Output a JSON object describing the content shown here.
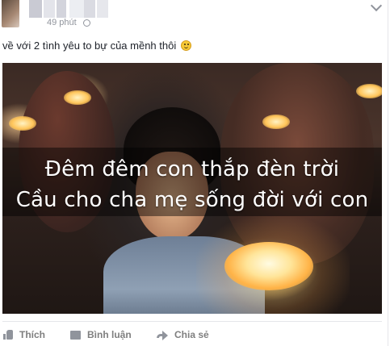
{
  "post": {
    "timestamp": "49 phút",
    "text": "về với 2 tình yêu to bự của mềnh thôi",
    "emoji": "smiley-icon",
    "privacy_icon": "globe-icon"
  },
  "photo": {
    "caption_line_1": "Đêm đêm con thắp đèn trời",
    "caption_line_2": "Cầu cho cha mẹ sống đời với con"
  },
  "actions": {
    "like_label": "Thích",
    "comment_label": "Bình luận",
    "share_label": "Chia sẻ"
  },
  "colors": {
    "text": "#1d2129",
    "meta": "#90949c",
    "action": "#7f7f7f",
    "divider": "#e5e6e9"
  }
}
